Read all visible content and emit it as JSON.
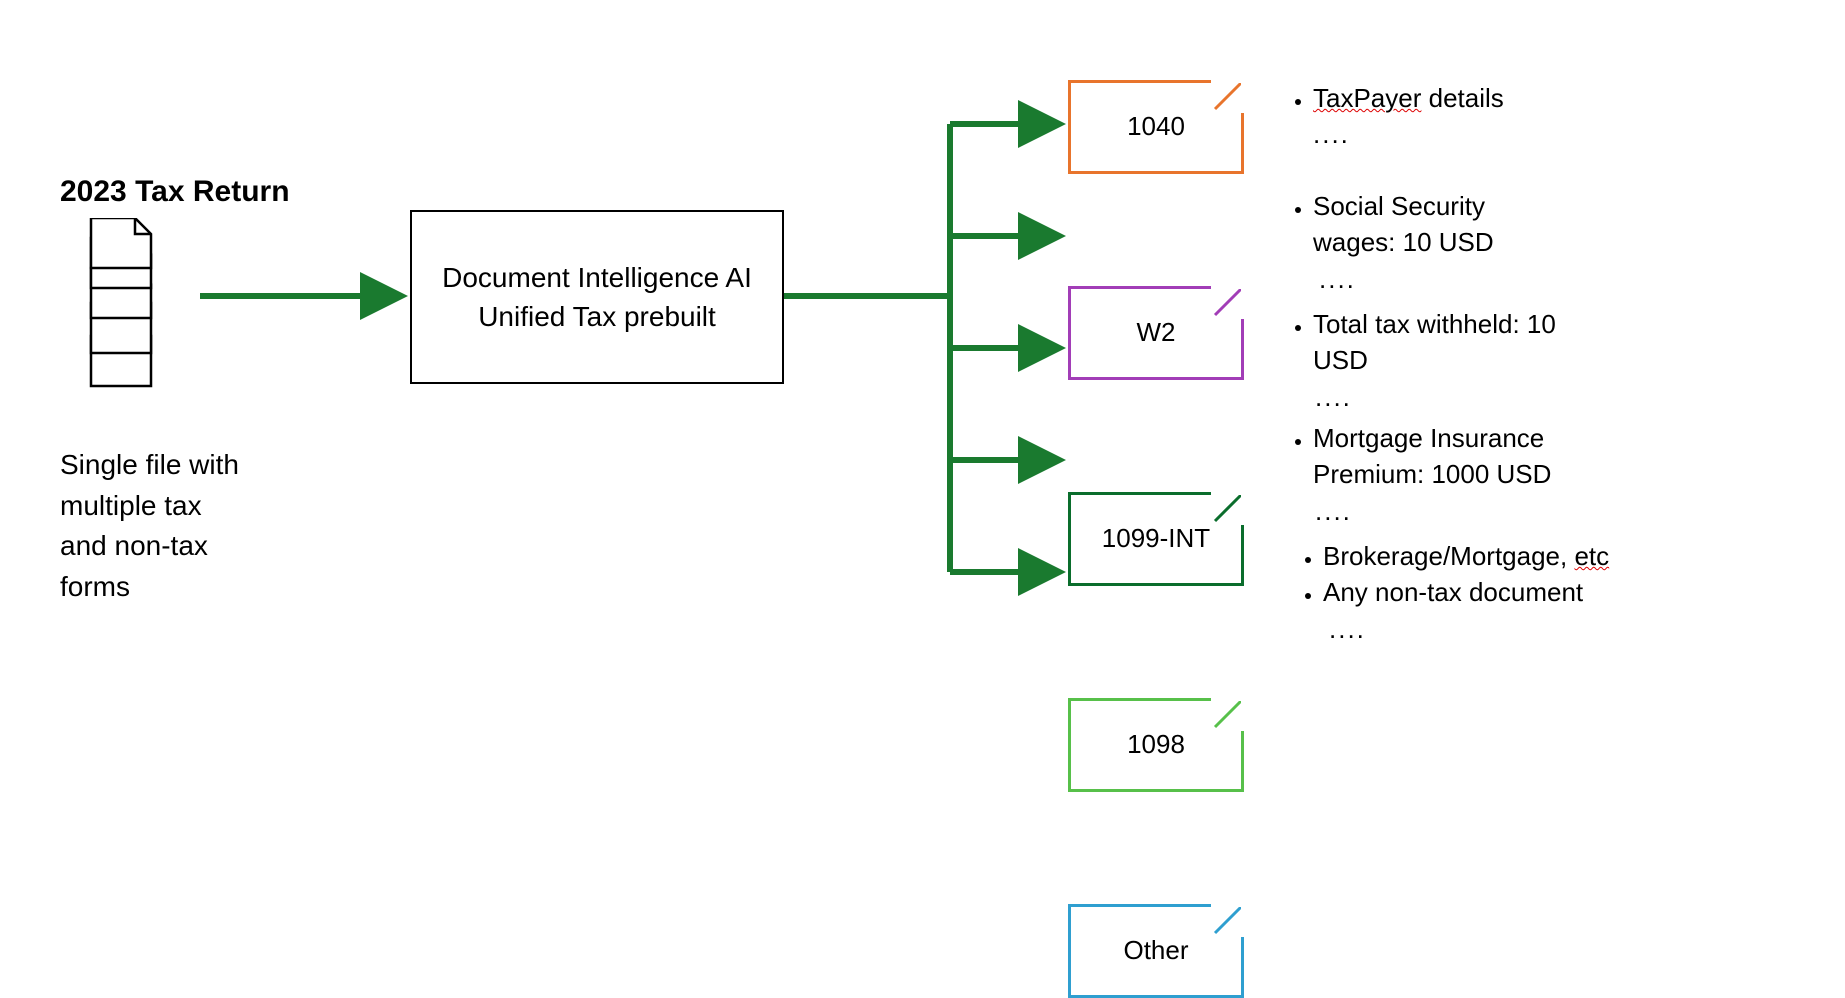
{
  "title": "2023 Tax Return",
  "input_caption_line1": "Single file with",
  "input_caption_line2": "multiple tax",
  "input_caption_line3": "and non-tax",
  "input_caption_line4": "forms",
  "processor_line1": "Document Intelligence AI",
  "processor_line2": "Unified Tax prebuilt",
  "outputs": {
    "box1": {
      "label": "1040",
      "color": "#e8742c"
    },
    "box2": {
      "label": "W2",
      "color": "#a23db7"
    },
    "box3": {
      "label": "1099-INT",
      "color": "#0a6d2c"
    },
    "box4": {
      "label": "1098",
      "color": "#57c04a"
    },
    "box5": {
      "label": "Other",
      "color": "#2f9fd0"
    }
  },
  "details": {
    "d1": {
      "item1": "TaxPayer details",
      "item1_underlined_part": "TaxPayer",
      "item1_rest": " details"
    },
    "d2": {
      "item1": "Social Security",
      "item2_indent": "wages: 10 USD"
    },
    "d3": {
      "item1": "Total tax withheld: 10",
      "item2_indent": "USD"
    },
    "d4": {
      "item1": "Mortgage Insurance",
      "item2_indent": "Premium: 1000 USD"
    },
    "d5": {
      "item1_prefix": "Brokerage/Mortgage, ",
      "item1_underlined": "etc",
      "item2": "Any non-tax document"
    }
  },
  "ellipsis": "....",
  "arrow_color": "#1a7a2f"
}
